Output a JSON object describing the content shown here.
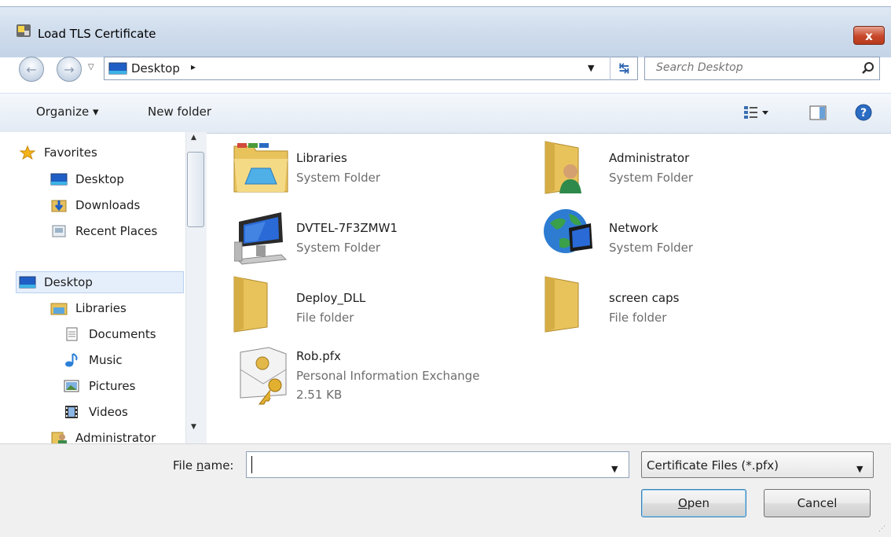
{
  "window": {
    "title": "Load TLS Certificate",
    "close_label": "x"
  },
  "address_bar": {
    "location": "Desktop",
    "separator": "▸"
  },
  "search": {
    "placeholder": "Search Desktop"
  },
  "command_bar": {
    "organize": "Organize ▾",
    "new_folder": "New folder"
  },
  "nav_pane": {
    "favorites_header": "Favorites",
    "favorites": [
      "Desktop",
      "Downloads",
      "Recent Places"
    ],
    "tree": {
      "desktop": "Desktop",
      "libraries": "Libraries",
      "library_items": [
        "Documents",
        "Music",
        "Pictures",
        "Videos"
      ],
      "administrator": "Administrator"
    }
  },
  "items": [
    {
      "name": "Libraries",
      "type": "System Folder",
      "icon": "libraries-icon"
    },
    {
      "name": "Administrator",
      "type": "System Folder",
      "icon": "user-folder-icon"
    },
    {
      "name": "DVTEL-7F3ZMW1",
      "type": "System Folder",
      "icon": "computer-icon"
    },
    {
      "name": "Network",
      "type": "System Folder",
      "icon": "network-globe-icon"
    },
    {
      "name": "Deploy_DLL",
      "type": "File folder",
      "icon": "folder-icon"
    },
    {
      "name": "screen caps",
      "type": "File folder",
      "icon": "folder-icon"
    },
    {
      "name": "Rob.pfx",
      "type": "Personal Information Exchange",
      "size": "2.51 KB",
      "icon": "certificate-file-icon"
    }
  ],
  "bottom": {
    "file_name_label_pre": "File ",
    "file_name_label_u": "n",
    "file_name_label_post": "ame:",
    "file_name_value": "",
    "file_type": "Certificate Files  (*.pfx)",
    "open_u": "O",
    "open_rest": "pen",
    "cancel": "Cancel"
  }
}
